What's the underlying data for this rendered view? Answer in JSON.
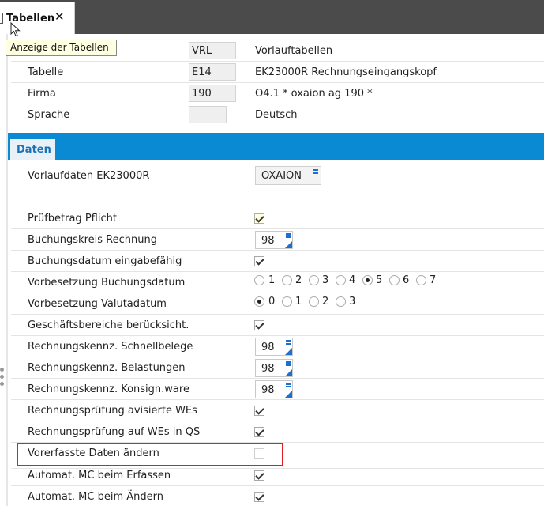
{
  "tab": {
    "label": "Tabellen",
    "close": "✕"
  },
  "tooltip": "Anzeige der Tabellen",
  "header": {
    "vrl_value": "VRL",
    "vrl_desc": "Vorlauftabellen",
    "tabelle_label": "Tabelle",
    "tabelle_value": "E14",
    "tabelle_desc": "EK23000R Rechnungseingangskopf",
    "firma_label": "Firma",
    "firma_value": "190",
    "firma_desc": "O4.1 * oxaion ag 190   *",
    "sprache_label": "Sprache",
    "sprache_value": "",
    "sprache_desc": "Deutsch"
  },
  "section_tab": "Daten",
  "vorlauf": {
    "label": "Vorlaufdaten EK23000R",
    "value": "OXAION"
  },
  "rows": {
    "pruefbetrag": {
      "label": "Prüfbetrag Pflicht",
      "checked": true
    },
    "buchungskreis": {
      "label": "Buchungskreis Rechnung",
      "value": "98"
    },
    "buchungsdatum": {
      "label": "Buchungsdatum eingabefähig",
      "checked": true
    },
    "vorbes_buchung": {
      "label": "Vorbesetzung Buchungsdatum",
      "options": [
        "1",
        "2",
        "3",
        "4",
        "5",
        "6",
        "7"
      ],
      "selected": "5"
    },
    "vorbes_valuta": {
      "label": "Vorbesetzung Valutadatum",
      "options": [
        "0",
        "1",
        "2",
        "3"
      ],
      "selected": "0"
    },
    "geschaeft": {
      "label": "Geschäftsbereiche berücksicht.",
      "checked": true
    },
    "schnell": {
      "label": "Rechnungskennz. Schnellbelege",
      "value": "98"
    },
    "belastungen": {
      "label": "Rechnungskennz. Belastungen",
      "value": "98"
    },
    "konsign": {
      "label": "Rechnungskennz. Konsign.ware",
      "value": "98"
    },
    "avisiert": {
      "label": "Rechnungsprüfung avisierte WEs",
      "checked": true
    },
    "qs": {
      "label": "Rechnungsprüfung auf WEs in QS",
      "checked": true
    },
    "vorerfasst": {
      "label": "Vorerfasste Daten ändern",
      "checked": false
    },
    "mc_erfassen": {
      "label": "Automat. MC beim Erfassen",
      "checked": true
    },
    "mc_aendern": {
      "label": "Automat. MC beim Ändern",
      "checked": true
    }
  },
  "colors": {
    "accent": "#0a8ad3",
    "highlight_border": "#e02020",
    "topbar": "#4b4b4b"
  }
}
